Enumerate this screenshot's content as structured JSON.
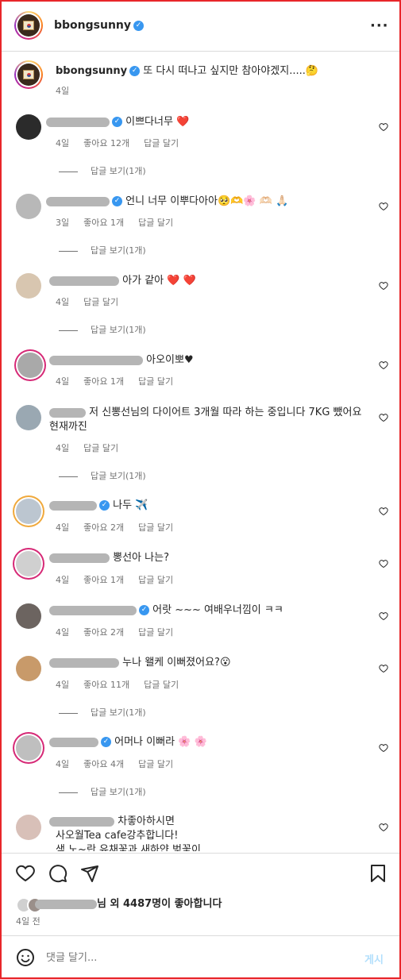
{
  "header": {
    "username": "bbongsunny",
    "more_icon": "more-icon"
  },
  "caption": {
    "username": "bbongsunny",
    "text": "또 다시 떠나고 싶지만 참아야겠지.....🤔",
    "time": "4일"
  },
  "comments": [
    {
      "text": "이쁘다너무 ❤️",
      "time": "4일",
      "likes": "좋아요 12개",
      "reply": "답글 달기",
      "view_replies": "답글 보기(1개)"
    },
    {
      "text": "언니 너무 이뿌다아아🥺🫶🌸 🫶🏻 🙏🏻",
      "time": "3일",
      "likes": "좋아요 1개",
      "reply": "답글 달기",
      "view_replies": "답글 보기(1개)"
    },
    {
      "text": "아가 같아 ❤️ ❤️",
      "time": "4일",
      "reply": "답글 달기",
      "view_replies": "답글 보기(1개)"
    },
    {
      "text": "아오이뽀♥",
      "time": "4일",
      "likes": "좋아요 1개",
      "reply": "답글 달기"
    },
    {
      "text": "저 신뽕선님의 다이어트 3개월 따라 하는 중입니다 7KG 뺐어요 현재까진",
      "time": "4일",
      "reply": "답글 달기",
      "view_replies": "답글 보기(1개)"
    },
    {
      "text": "나두 ✈️",
      "time": "4일",
      "likes": "좋아요 2개",
      "reply": "답글 달기"
    },
    {
      "text": "뽕선아 나는?",
      "time": "4일",
      "likes": "좋아요 1개",
      "reply": "답글 달기"
    },
    {
      "text": "어랏 ~~~ 여배우너낌이 ㅋㅋ",
      "time": "4일",
      "likes": "좋아요 2개",
      "reply": "답글 달기"
    },
    {
      "text": "누나 왤케 이뻐졌어요?😮",
      "time": "4일",
      "likes": "좋아요 11개",
      "reply": "답글 달기",
      "view_replies": "답글 보기(1개)"
    },
    {
      "text": "어머나 이뻐라 🌸 🌸",
      "time": "4일",
      "likes": "좋아요 4개",
      "reply": "답글 달기",
      "view_replies": "답글 보기(1개)"
    },
    {
      "text": "차좋아하시면",
      "line2": "사오월Tea cafe강추합니다!",
      "line3": "색 노~란 유채꽃과 새하얀 벚꽃이"
    }
  ],
  "likes_summary": {
    "text": "님 외 4487명이 좋아합니다",
    "time": "4일 전"
  },
  "comment_input": {
    "placeholder": "댓글 달기...",
    "post_label": "게시"
  },
  "colors": {
    "accent": "#3897f0",
    "border": "#e8262a",
    "heart_red": "#ed4956"
  }
}
